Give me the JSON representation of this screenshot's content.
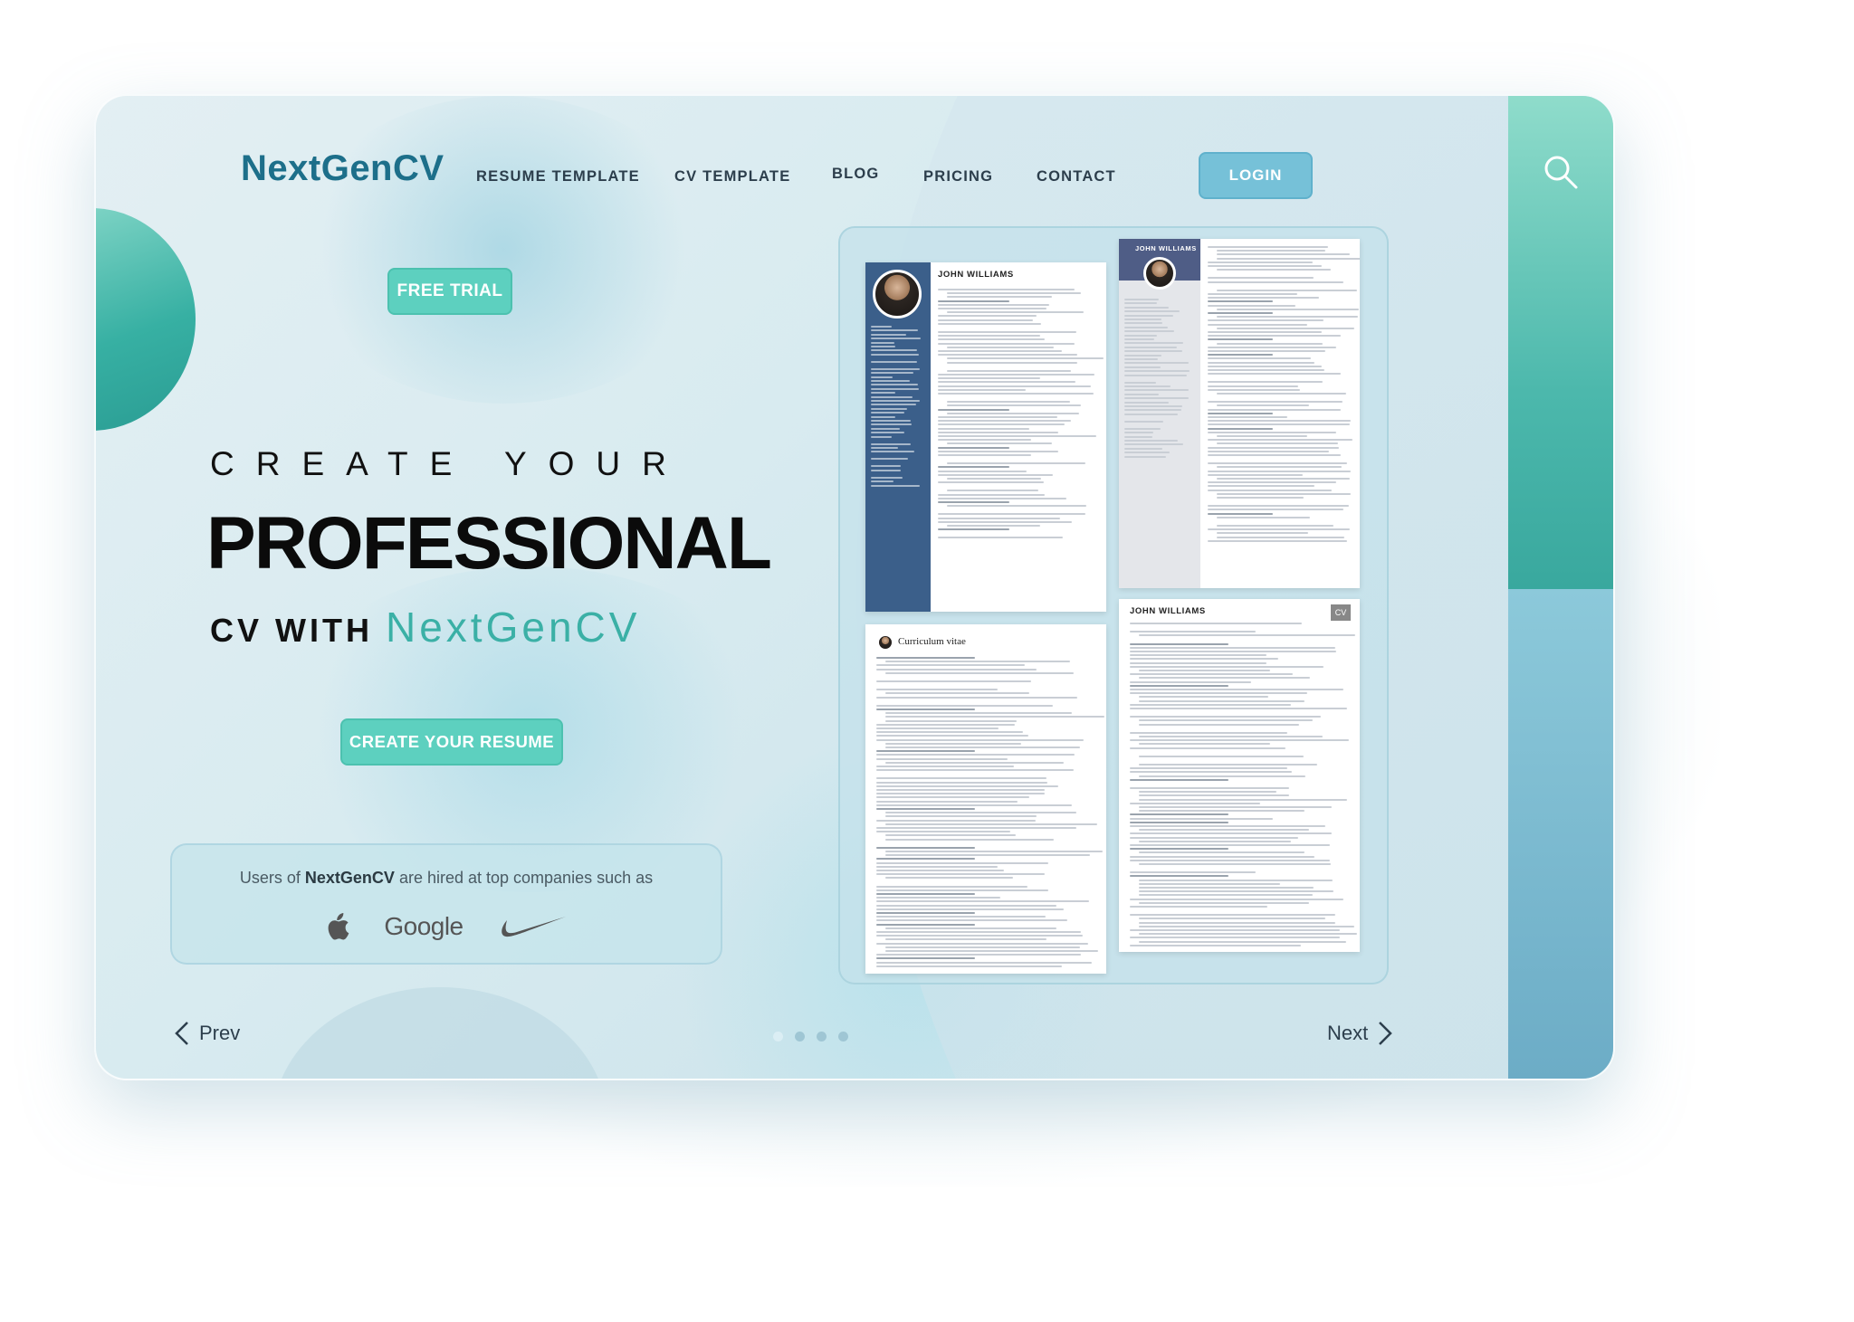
{
  "brand": {
    "logo": "NextGenCV"
  },
  "nav": {
    "items": [
      "RESUME TEMPLATE",
      "CV TEMPLATE",
      "BLOG",
      "PRICING",
      "CONTACT"
    ],
    "login": "LOGIN"
  },
  "hero": {
    "badge": "FREE TRIAL",
    "line1": "CREATE YOUR",
    "line2": "PROFESSIONAL",
    "line3_prefix": "CV WITH",
    "line3_brand": "NextGenCV",
    "cta": "CREATE YOUR RESUME"
  },
  "companies": {
    "text_prefix": "Users of",
    "text_brand": "NextGenCV",
    "text_suffix": "are hired at top companies such as",
    "logos": [
      "apple-logo",
      "Google",
      "nike-logo"
    ]
  },
  "pager": {
    "prev": "Prev",
    "next": "Next",
    "count": 4,
    "active": 0
  },
  "templates": [
    {
      "name": "JOHN WILLIAMS"
    },
    {
      "name": "JOHN WILLIAMS"
    },
    {
      "name": "Curriculum vitae"
    },
    {
      "name": "JOHN WILLIAMS",
      "badge": "CV"
    }
  ],
  "colors": {
    "accent": "#5dd0bf",
    "brand": "#1d6f8a",
    "login": "#76c1d8",
    "sidebar_top": "#4cb8ac",
    "sidebar_bottom": "#6cacc6"
  },
  "icons": {
    "search": "search-icon",
    "prev": "chevron-left-icon",
    "next": "chevron-right-icon"
  }
}
